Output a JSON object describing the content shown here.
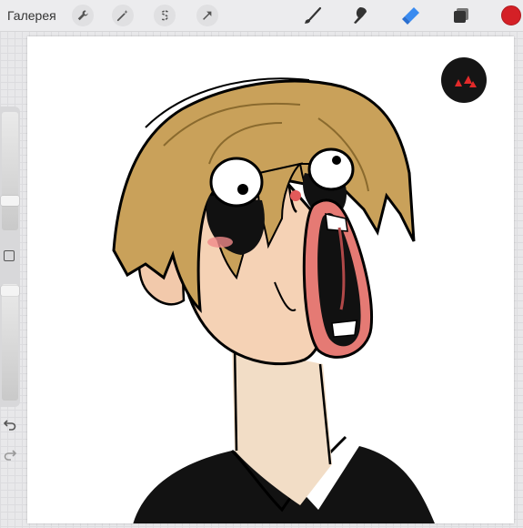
{
  "toolbar": {
    "gallery_label": "Галерея",
    "left_tools": [
      {
        "icon": "wrench-icon"
      },
      {
        "icon": "magic-wand-icon"
      },
      {
        "icon": "selection-s-icon"
      },
      {
        "icon": "transform-arrow-icon"
      }
    ],
    "right_tools": [
      {
        "icon": "brush-icon"
      },
      {
        "icon": "smudge-icon"
      },
      {
        "icon": "eraser-icon",
        "active_color": "#3a8bf0"
      },
      {
        "icon": "layers-icon"
      }
    ],
    "current_color": "#d42026"
  },
  "sidebar": {
    "items": [
      {
        "icon": "brush-size-slider"
      },
      {
        "icon": "modify-square-icon"
      },
      {
        "icon": "opacity-slider"
      },
      {
        "icon": "undo-icon"
      },
      {
        "icon": "redo-icon"
      }
    ]
  },
  "canvas": {
    "background": "#ffffff",
    "artwork": "cartoon-character-screaming"
  }
}
